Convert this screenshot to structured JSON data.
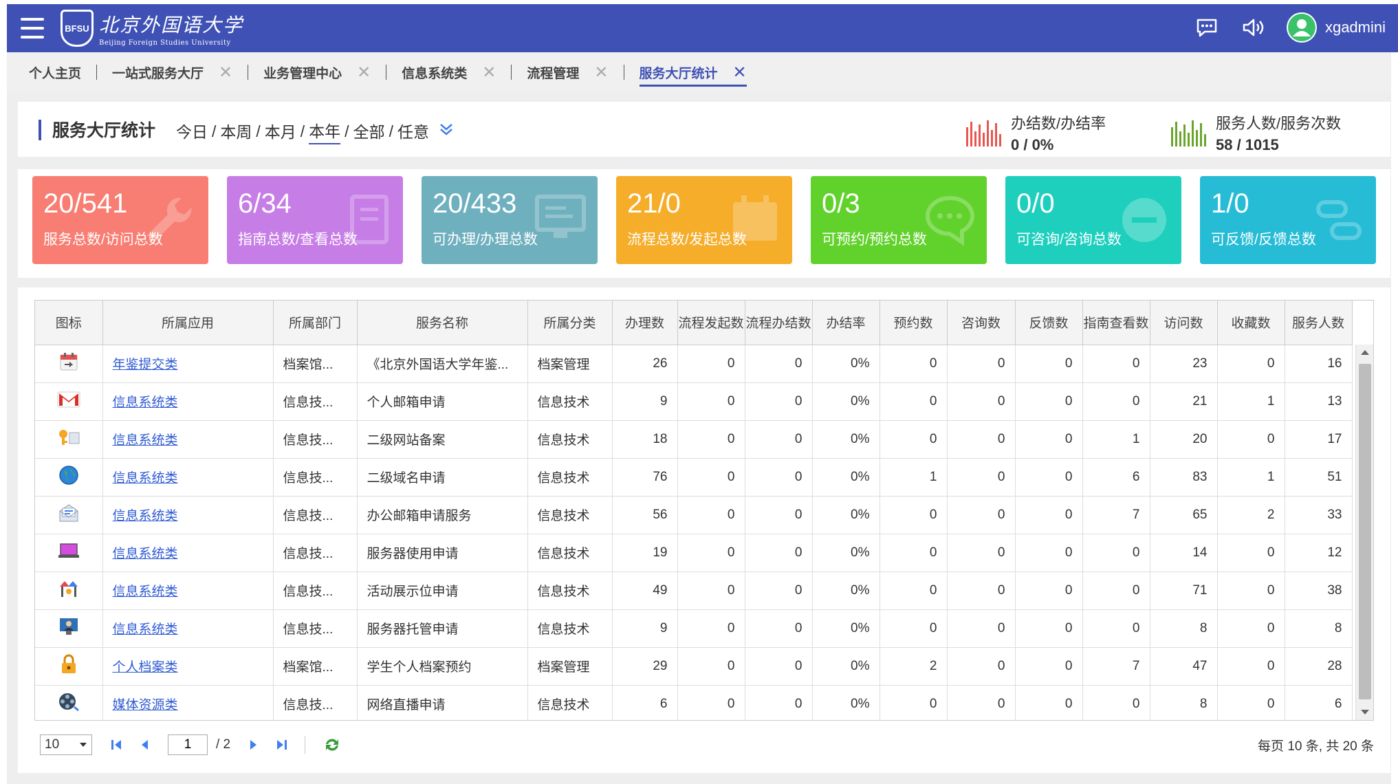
{
  "header": {
    "logo_cn": "北京外国语大学",
    "logo_en": "Beijing Foreign Studies University",
    "logo_seal": "BFSU",
    "username": "xgadmini"
  },
  "tabs": [
    {
      "label": "个人主页",
      "closable": false
    },
    {
      "label": "一站式服务大厅",
      "closable": true
    },
    {
      "label": "业务管理中心",
      "closable": true
    },
    {
      "label": "信息系统类",
      "closable": true
    },
    {
      "label": "流程管理",
      "closable": true
    },
    {
      "label": "服务大厅统计",
      "closable": true,
      "active": true
    }
  ],
  "page": {
    "title": "服务大厅统计",
    "periods": [
      "今日",
      "本周",
      "本月",
      "本年",
      "全部",
      "任意"
    ],
    "active_period": "本年",
    "stats": [
      {
        "label": "办结数/办结率",
        "value": "0 / 0%",
        "color": "#e8554e"
      },
      {
        "label": "服务人数/服务次数",
        "value": "58 / 1015",
        "color": "#6aa52a"
      }
    ]
  },
  "cards": [
    {
      "value": "20/541",
      "label": "服务总数/访问总数",
      "color": "#f87d72"
    },
    {
      "value": "6/34",
      "label": "指南总数/查看总数",
      "color": "#c77de6"
    },
    {
      "value": "20/433",
      "label": "可办理/办理总数",
      "color": "#6fb0be"
    },
    {
      "value": "21/0",
      "label": "流程总数/发起总数",
      "color": "#f5ad2a"
    },
    {
      "value": "0/3",
      "label": "可预约/预约总数",
      "color": "#61d22c"
    },
    {
      "value": "0/0",
      "label": "可咨询/咨询总数",
      "color": "#1fcfbd"
    },
    {
      "value": "1/0",
      "label": "可反馈/反馈总数",
      "color": "#26bcd6"
    }
  ],
  "table": {
    "columns": [
      "图标",
      "所属应用",
      "所属部门",
      "服务名称",
      "所属分类",
      "办理数",
      "流程发起数",
      "流程办结数",
      "办结率",
      "预约数",
      "咨询数",
      "反馈数",
      "指南查看数",
      "访问数",
      "收藏数",
      "服务人数"
    ],
    "rows": [
      {
        "icon": "calendar-icon",
        "app": "年鉴提交类",
        "dept": "档案馆...",
        "name": "《北京外国语大学年鉴...",
        "category": "档案管理",
        "handle": "26",
        "started": "0",
        "finished": "0",
        "rate": "0%",
        "appoint": "0",
        "consult": "0",
        "feedback": "0",
        "guide": "0",
        "visit": "23",
        "fav": "0",
        "people": "16"
      },
      {
        "icon": "gmail-icon",
        "app": "信息系统类",
        "dept": "信息技...",
        "name": "个人邮箱申请",
        "category": "信息技术",
        "handle": "9",
        "started": "0",
        "finished": "0",
        "rate": "0%",
        "appoint": "0",
        "consult": "0",
        "feedback": "0",
        "guide": "0",
        "visit": "21",
        "fav": "1",
        "people": "13"
      },
      {
        "icon": "key-icon",
        "app": "信息系统类",
        "dept": "信息技...",
        "name": "二级网站备案",
        "category": "信息技术",
        "handle": "18",
        "started": "0",
        "finished": "0",
        "rate": "0%",
        "appoint": "0",
        "consult": "0",
        "feedback": "0",
        "guide": "1",
        "visit": "20",
        "fav": "0",
        "people": "17"
      },
      {
        "icon": "globe-icon",
        "app": "信息系统类",
        "dept": "信息技...",
        "name": "二级域名申请",
        "category": "信息技术",
        "handle": "76",
        "started": "0",
        "finished": "0",
        "rate": "0%",
        "appoint": "1",
        "consult": "0",
        "feedback": "0",
        "guide": "6",
        "visit": "83",
        "fav": "1",
        "people": "51"
      },
      {
        "icon": "mail-open-icon",
        "app": "信息系统类",
        "dept": "信息技...",
        "name": "办公邮箱申请服务",
        "category": "信息技术",
        "handle": "56",
        "started": "0",
        "finished": "0",
        "rate": "0%",
        "appoint": "0",
        "consult": "0",
        "feedback": "0",
        "guide": "7",
        "visit": "65",
        "fav": "2",
        "people": "33"
      },
      {
        "icon": "laptop-icon",
        "app": "信息系统类",
        "dept": "信息技...",
        "name": "服务器使用申请",
        "category": "信息技术",
        "handle": "19",
        "started": "0",
        "finished": "0",
        "rate": "0%",
        "appoint": "0",
        "consult": "0",
        "feedback": "0",
        "guide": "0",
        "visit": "14",
        "fav": "0",
        "people": "12"
      },
      {
        "icon": "booth-icon",
        "app": "信息系统类",
        "dept": "信息技...",
        "name": "活动展示位申请",
        "category": "信息技术",
        "handle": "49",
        "started": "0",
        "finished": "0",
        "rate": "0%",
        "appoint": "0",
        "consult": "0",
        "feedback": "0",
        "guide": "0",
        "visit": "71",
        "fav": "0",
        "people": "38"
      },
      {
        "icon": "monitor-user-icon",
        "app": "信息系统类",
        "dept": "信息技...",
        "name": "服务器托管申请",
        "category": "信息技术",
        "handle": "9",
        "started": "0",
        "finished": "0",
        "rate": "0%",
        "appoint": "0",
        "consult": "0",
        "feedback": "0",
        "guide": "0",
        "visit": "8",
        "fav": "0",
        "people": "8"
      },
      {
        "icon": "lock-icon",
        "app": "个人档案类",
        "dept": "档案馆...",
        "name": "学生个人档案预约",
        "category": "档案管理",
        "handle": "29",
        "started": "0",
        "finished": "0",
        "rate": "0%",
        "appoint": "2",
        "consult": "0",
        "feedback": "0",
        "guide": "7",
        "visit": "47",
        "fav": "0",
        "people": "28"
      },
      {
        "icon": "film-reel-icon",
        "app": "媒体资源类",
        "dept": "信息技...",
        "name": "网络直播申请",
        "category": "信息技术",
        "handle": "6",
        "started": "0",
        "finished": "0",
        "rate": "0%",
        "appoint": "0",
        "consult": "0",
        "feedback": "0",
        "guide": "0",
        "visit": "8",
        "fav": "0",
        "people": "6"
      }
    ]
  },
  "pager": {
    "page_size": "10",
    "current_page": "1",
    "total_pages": "/ 2",
    "info": "每页 10 条, 共 20 条"
  }
}
